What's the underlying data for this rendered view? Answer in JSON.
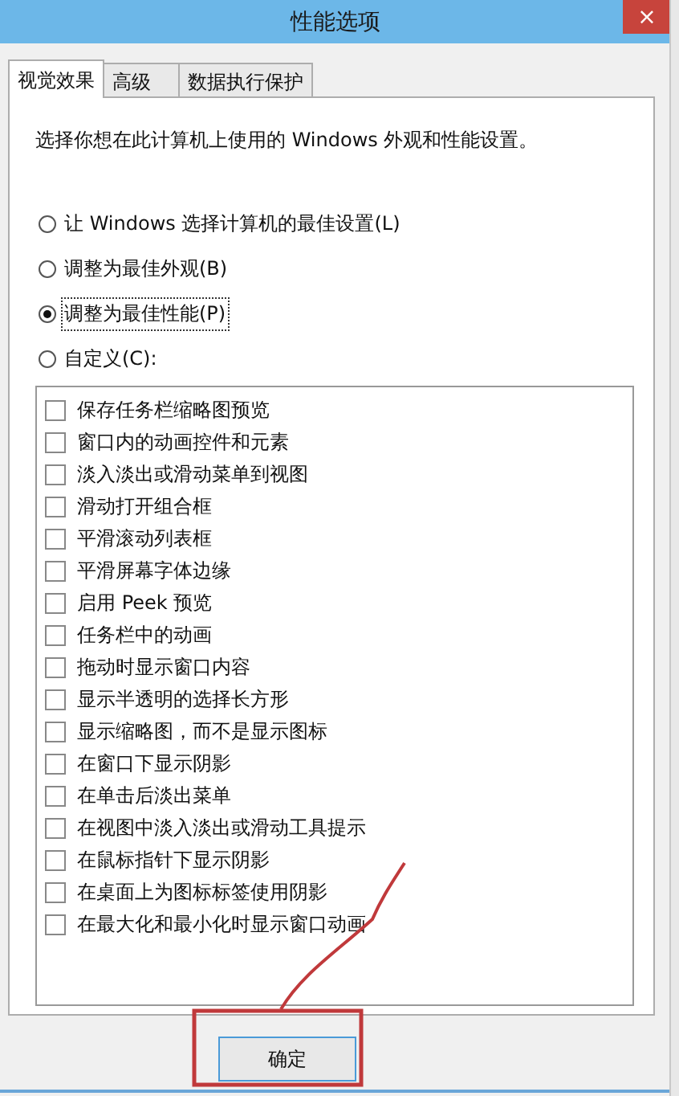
{
  "window": {
    "title": "性能选项",
    "close": "×"
  },
  "tabs": [
    {
      "label": "视觉效果",
      "selected": true
    },
    {
      "label": "高级",
      "selected": false
    },
    {
      "label": "数据执行保护",
      "selected": false
    }
  ],
  "description": "选择你想在此计算机上使用的 Windows 外观和性能设置。",
  "options": [
    {
      "label": "让 Windows 选择计算机的最佳设置(L)",
      "selected": false
    },
    {
      "label": "调整为最佳外观(B)",
      "selected": false
    },
    {
      "label": "调整为最佳性能(P)",
      "selected": true
    },
    {
      "label": "自定义(C):",
      "selected": false
    }
  ],
  "effects": [
    {
      "label": "保存任务栏缩略图预览",
      "checked": false
    },
    {
      "label": "窗口内的动画控件和元素",
      "checked": false
    },
    {
      "label": "淡入淡出或滑动菜单到视图",
      "checked": false
    },
    {
      "label": "滑动打开组合框",
      "checked": false
    },
    {
      "label": "平滑滚动列表框",
      "checked": false
    },
    {
      "label": "平滑屏幕字体边缘",
      "checked": false
    },
    {
      "label": "启用 Peek 预览",
      "checked": false
    },
    {
      "label": "任务栏中的动画",
      "checked": false
    },
    {
      "label": "拖动时显示窗口内容",
      "checked": false
    },
    {
      "label": "显示半透明的选择长方形",
      "checked": false
    },
    {
      "label": "显示缩略图，而不是显示图标",
      "checked": false
    },
    {
      "label": "在窗口下显示阴影",
      "checked": false
    },
    {
      "label": "在单击后淡出菜单",
      "checked": false
    },
    {
      "label": "在视图中淡入淡出或滑动工具提示",
      "checked": false
    },
    {
      "label": "在鼠标指针下显示阴影",
      "checked": false
    },
    {
      "label": "在桌面上为图标标签使用阴影",
      "checked": false
    },
    {
      "label": "在最大化和最小化时显示窗口动画",
      "checked": false
    }
  ],
  "buttons": [
    {
      "label": "确定"
    }
  ]
}
